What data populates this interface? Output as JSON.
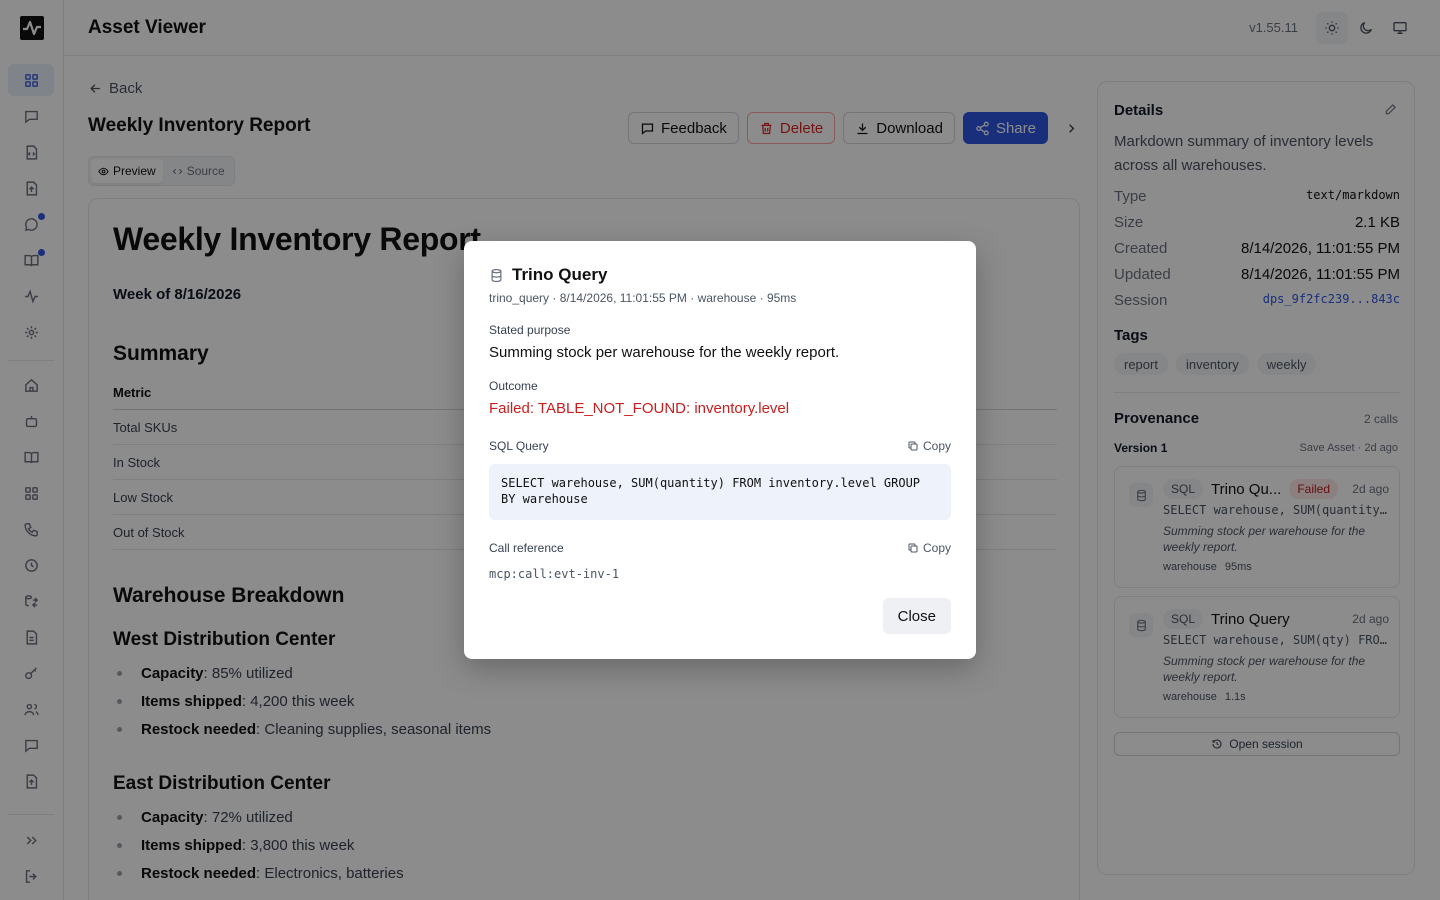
{
  "app": {
    "title": "Asset Viewer",
    "version": "v1.55.11"
  },
  "theme": {
    "options": [
      "light",
      "dark",
      "system"
    ],
    "selected": "light"
  },
  "nav": {
    "back_label": "Back",
    "items": [
      {
        "icon": "grid-icon",
        "active": true
      },
      {
        "icon": "message-icon"
      },
      {
        "icon": "file-code-icon"
      },
      {
        "icon": "file-upload-icon"
      },
      {
        "icon": "chat-icon",
        "badge": true
      },
      {
        "icon": "book-open-icon",
        "badge": true
      },
      {
        "icon": "activity-icon"
      },
      {
        "icon": "settings-icon"
      },
      {
        "icon": "home-icon"
      },
      {
        "icon": "bot-icon"
      },
      {
        "icon": "book-icon"
      },
      {
        "icon": "apps-icon"
      },
      {
        "icon": "phone-icon"
      },
      {
        "icon": "clock-icon"
      },
      {
        "icon": "database-swap-icon"
      },
      {
        "icon": "file-text-icon"
      },
      {
        "icon": "key-icon"
      },
      {
        "icon": "users-icon"
      },
      {
        "icon": "message-square-icon"
      },
      {
        "icon": "file-upload-icon"
      }
    ]
  },
  "asset": {
    "title": "Weekly Inventory Report",
    "actions": {
      "feedback": "Feedback",
      "delete": "Delete",
      "download": "Download",
      "share": "Share"
    },
    "view_tabs": {
      "preview": "Preview",
      "source": "Source",
      "selected": "Preview"
    }
  },
  "document": {
    "h1": "Weekly Inventory Report",
    "week": "Week of 8/16/2026",
    "summary_heading": "Summary",
    "table": {
      "header": "Metric",
      "rows": [
        "Total SKUs",
        "In Stock",
        "Low Stock",
        "Out of Stock"
      ]
    },
    "breakdown_heading": "Warehouse Breakdown",
    "west": {
      "heading": "West Distribution Center",
      "items": [
        {
          "label": "Capacity",
          "value": ": 85% utilized"
        },
        {
          "label": "Items shipped",
          "value": ": 4,200 this week"
        },
        {
          "label": "Restock needed",
          "value": ": Cleaning supplies, seasonal items"
        }
      ]
    },
    "east": {
      "heading": "East Distribution Center",
      "items": [
        {
          "label": "Capacity",
          "value": ": 72% utilized"
        },
        {
          "label": "Items shipped",
          "value": ": 3,800 this week"
        },
        {
          "label": "Restock needed",
          "value": ": Electronics, batteries"
        }
      ]
    }
  },
  "details": {
    "title": "Details",
    "description": "Markdown summary of inventory levels across all warehouses.",
    "fields": {
      "type": {
        "label": "Type",
        "value": "text/markdown"
      },
      "size": {
        "label": "Size",
        "value": "2.1 KB"
      },
      "created": {
        "label": "Created",
        "value": "8/14/2026, 11:01:55 PM"
      },
      "updated": {
        "label": "Updated",
        "value": "8/14/2026, 11:01:55 PM"
      },
      "session": {
        "label": "Session",
        "value": "dps_9f2fc239...843c"
      }
    },
    "tags_title": "Tags",
    "tags": [
      "report",
      "inventory",
      "weekly"
    ],
    "provenance": {
      "title": "Provenance",
      "count": "2 calls",
      "version_label": "Version 1",
      "version_meta": "Save Asset · 2d ago",
      "calls": [
        {
          "badge": "SQL",
          "name": "Trino Qu...",
          "status": "Failed",
          "time": "2d ago",
          "sql": "SELECT warehouse, SUM(quantity…",
          "purpose": "Summing stock per warehouse for the weekly report.",
          "tag": "warehouse",
          "duration": "95ms"
        },
        {
          "badge": "SQL",
          "name": "Trino Query",
          "status": "",
          "time": "2d ago",
          "sql": "SELECT warehouse, SUM(qty) FRO…",
          "purpose": "Summing stock per warehouse for the weekly report.",
          "tag": "warehouse",
          "duration": "1.1s"
        }
      ],
      "open_session": "Open session"
    }
  },
  "modal": {
    "title": "Trino Query",
    "meta": "trino_query · 8/14/2026, 11:01:55 PM · warehouse · 95ms",
    "purpose_label": "Stated purpose",
    "purpose": "Summing stock per warehouse for the weekly report.",
    "outcome_label": "Outcome",
    "outcome": "Failed: TABLE_NOT_FOUND: inventory.level",
    "sql_label": "SQL Query",
    "sql_line1": "SELECT warehouse, SUM(quantity) FROM inventory.level GROUP",
    "sql_line2": "BY warehouse",
    "copy_label": "Copy",
    "callref_label": "Call reference",
    "callref": "mcp:call:evt-inv-1",
    "close": "Close"
  },
  "colors": {
    "primary": "#2f56e0",
    "danger": "#dc2626",
    "error_text": "#c81e1e",
    "failed_badge_bg": "#fde8e8"
  }
}
